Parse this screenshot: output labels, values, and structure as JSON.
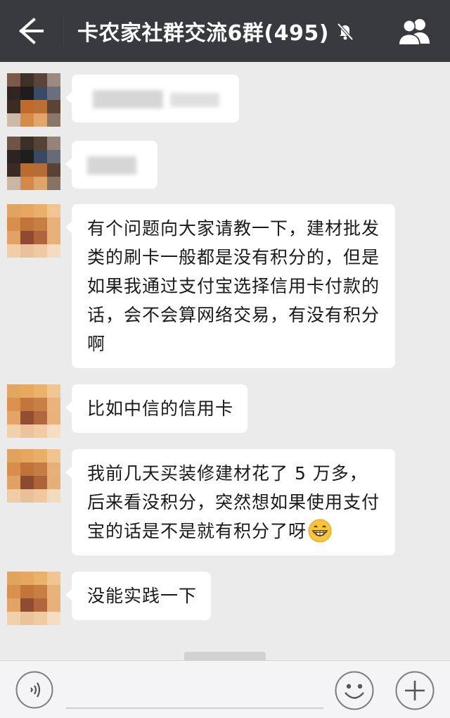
{
  "header": {
    "back_icon": "arrow-left-icon",
    "title": "卡农家社群交流6群(495)",
    "mute_icon": "bell-off-icon",
    "group_icon": "group-members-icon",
    "background": "#393a3f"
  },
  "messages": [
    {
      "avatar": "blurred-avatar",
      "text": "",
      "blurred": true
    },
    {
      "avatar": "blurred-avatar",
      "text": "",
      "blurred": true
    },
    {
      "avatar": "blurred-avatar",
      "text": "有个问题向大家请教一下，建材批发类的刷卡一般都是没有积分的，但是如果我通过支付宝选择信用卡付款的话，会不会算网络交易，有没有积分啊",
      "blurred": false
    },
    {
      "avatar": "blurred-avatar",
      "text": "比如中信的信用卡",
      "blurred": false
    },
    {
      "avatar": "blurred-avatar",
      "text": "我前几天买装修建材花了 5 万多，后来看没积分，突然想如果使用支付宝的话是不是就有积分了呀",
      "emoji": "grinning-face-icon",
      "blurred": false
    },
    {
      "avatar": "blurred-avatar",
      "text": "没能实践一下",
      "blurred": false
    }
  ],
  "input_bar": {
    "voice_icon": "voice-input-icon",
    "input_value": "",
    "emoji_icon": "emoji-face-icon",
    "plus_icon": "plus-icon"
  },
  "colors": {
    "chat_background": "#ebebeb",
    "bubble": "#ffffff",
    "input_bar": "#f4f4f6"
  }
}
